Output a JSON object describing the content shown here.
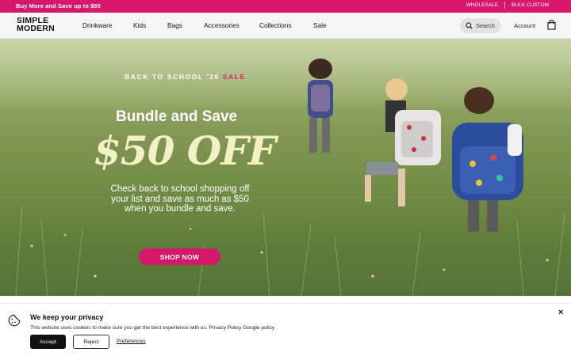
{
  "topbar": {
    "promo": "Buy More and Save up to $50",
    "links": [
      "WHOLESALE",
      "BULK CUSTOM"
    ]
  },
  "nav": {
    "logo_line1": "SIMPLE",
    "logo_line2": "MODERN",
    "menu": [
      "Drinkware",
      "Kids",
      "Bags",
      "Accessories",
      "Collections",
      "Sale"
    ],
    "search_label": "Search",
    "account_label": "Account",
    "icons": [
      "search-icon",
      "shopping-bag-icon"
    ]
  },
  "hero": {
    "eyebrow": "BACK TO SCHOOL '26",
    "eyebrow_sale": "SALE",
    "headline": "Bundle and Save",
    "offer": "$50 OFF",
    "subcopy": "Check back to school shopping off your list and save as much as $50 when you bundle and save.",
    "cta": "SHOP NOW"
  },
  "cookie_banner": {
    "title": "We keep your privacy",
    "text": "This website uses cookies to make sure you get the best experience with us. Privacy Policy Google policy",
    "accept": "Accept",
    "reject": "Reject",
    "preferences": "Preferences",
    "close": "×",
    "icons": [
      "cookie-icon",
      "close-icon"
    ]
  },
  "colors": {
    "brand_pink": "#d6176a",
    "offer_cream": "#f4efc5",
    "nav_bg": "#f6f6f6"
  }
}
